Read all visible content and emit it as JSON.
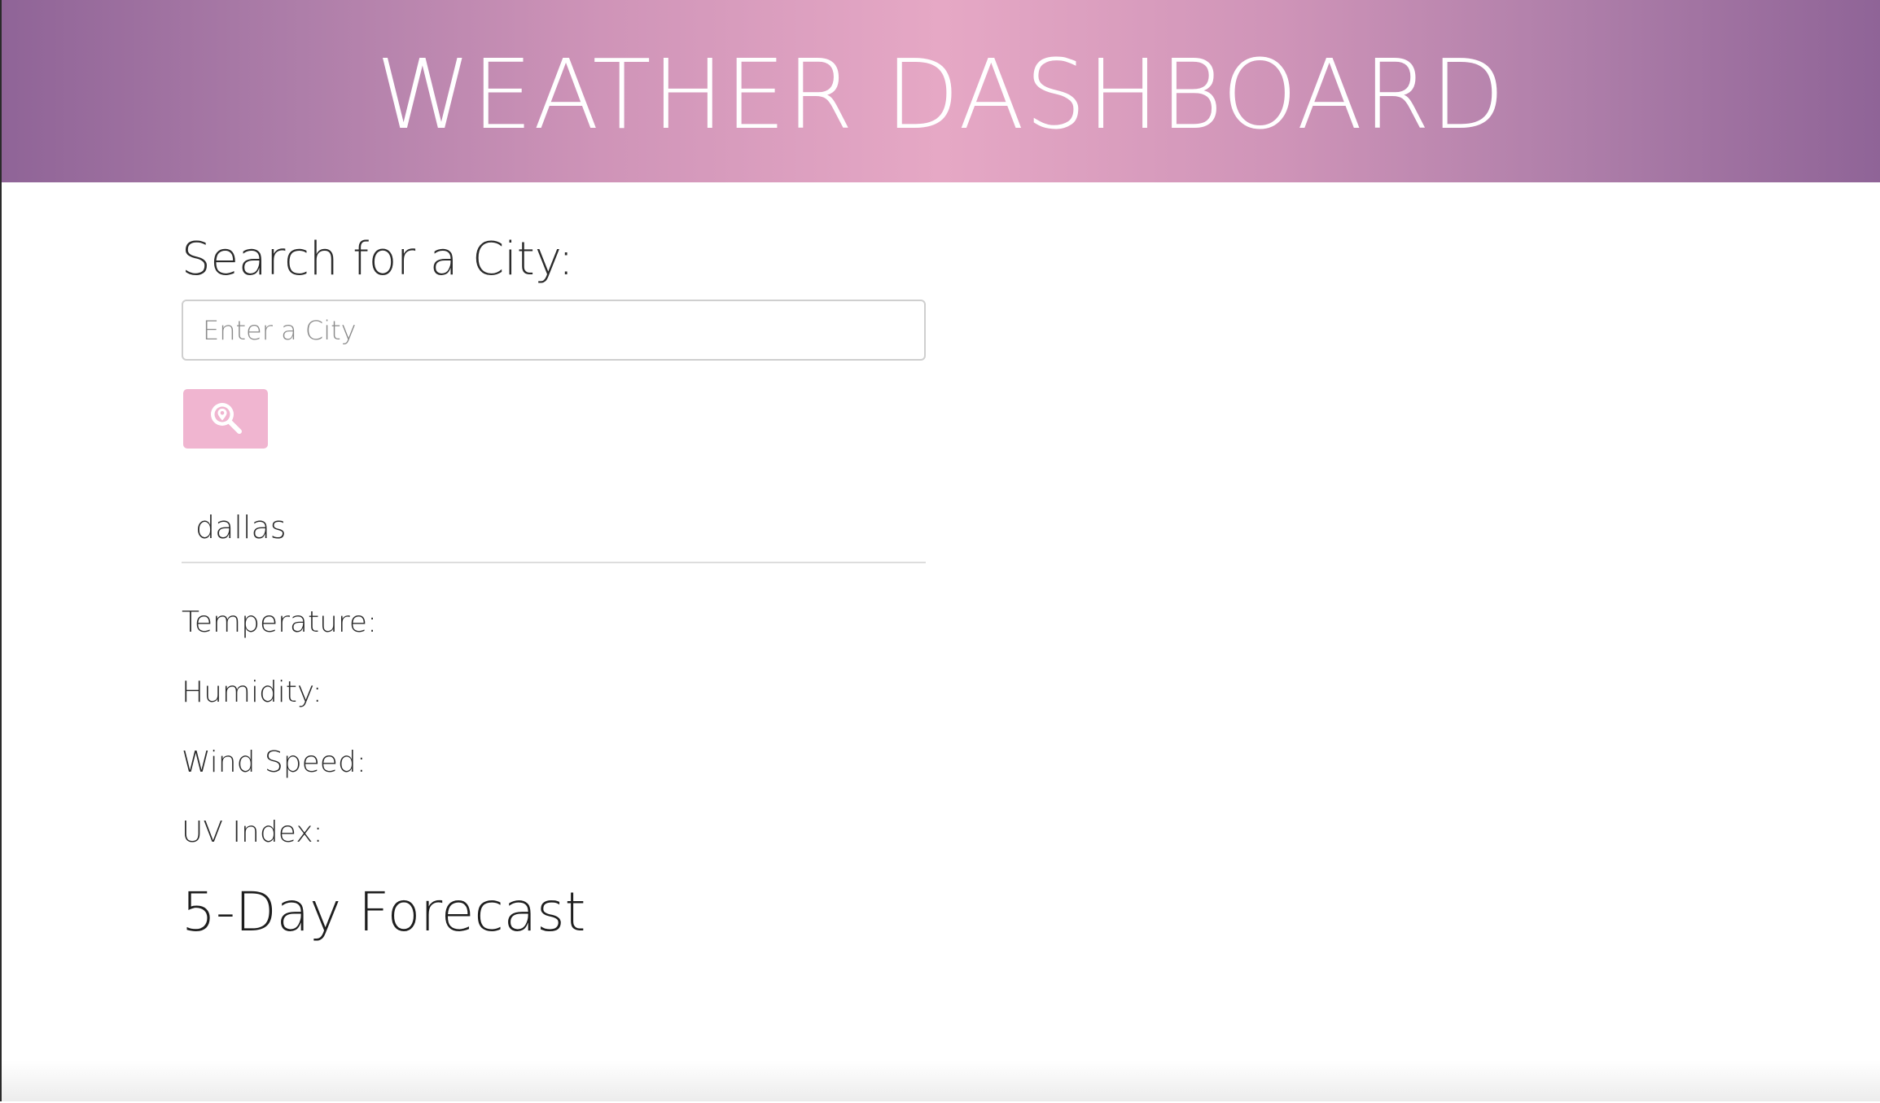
{
  "header": {
    "title": "WEATHER DASHBOARD"
  },
  "search": {
    "heading": "Search for a City:",
    "placeholder": "Enter a City",
    "value": "",
    "button_icon": "search-location-icon"
  },
  "history": {
    "items": [
      "dallas"
    ]
  },
  "current": {
    "temperature_label": "Temperature:",
    "humidity_label": "Humidity:",
    "wind_label": "Wind Speed:",
    "uv_label": "UV Index:"
  },
  "forecast": {
    "heading": "5-Day Forecast"
  },
  "colors": {
    "header_gradient_edge": "#8f6497",
    "header_gradient_center": "#e6a8c5",
    "button_background": "#f0b5d0",
    "text": "#2b2b2b"
  }
}
